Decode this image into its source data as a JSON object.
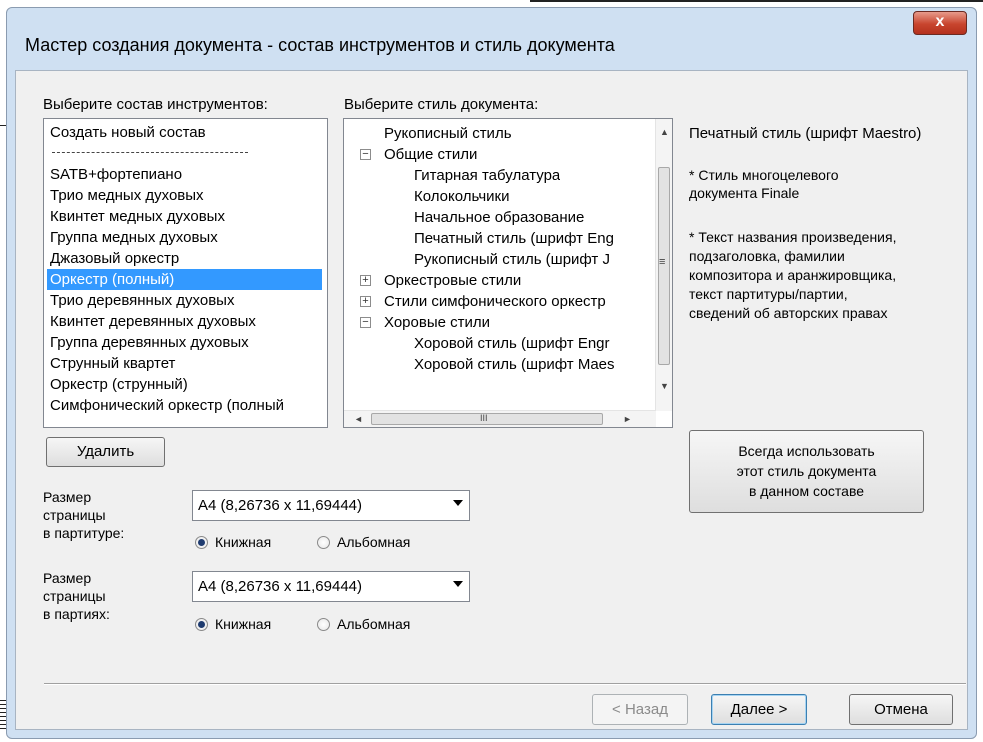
{
  "dialog": {
    "title": "Мастер создания документа - состав инструментов и стиль документа",
    "close_label": "x"
  },
  "ensemble": {
    "label": "Выберите состав инструментов:",
    "items": [
      {
        "label": "Создать новый состав",
        "selected": false
      },
      {
        "label": "SATB+фортепиано",
        "selected": false
      },
      {
        "label": "Трио медных духовых",
        "selected": false
      },
      {
        "label": "Квинтет медных духовых",
        "selected": false
      },
      {
        "label": "Группа медных духовых",
        "selected": false
      },
      {
        "label": "Джазовый оркестр",
        "selected": false
      },
      {
        "label": "Оркестр (полный)",
        "selected": true
      },
      {
        "label": "Трио деревянных духовых",
        "selected": false
      },
      {
        "label": "Квинтет деревянных духовых",
        "selected": false
      },
      {
        "label": "Группа деревянных духовых",
        "selected": false
      },
      {
        "label": "Струнный квартет",
        "selected": false
      },
      {
        "label": "Оркестр (струнный)",
        "selected": false
      },
      {
        "label": "Симфонический оркестр (полный",
        "selected": false
      }
    ],
    "delete_label": "Удалить"
  },
  "style": {
    "label": "Выберите стиль документа:",
    "tree": [
      {
        "label": "Рукописный стиль",
        "level": 0,
        "expander": ""
      },
      {
        "label": "Общие стили",
        "level": 0,
        "expander": "−"
      },
      {
        "label": "Гитарная табулатура",
        "level": 1,
        "expander": ""
      },
      {
        "label": "Колокольчики",
        "level": 1,
        "expander": ""
      },
      {
        "label": "Начальное образование",
        "level": 1,
        "expander": ""
      },
      {
        "label": "Печатный стиль (шрифт Eng",
        "level": 1,
        "expander": ""
      },
      {
        "label": "Рукописный стиль (шрифт J",
        "level": 1,
        "expander": ""
      },
      {
        "label": "Оркестровые стили",
        "level": 0,
        "expander": "+"
      },
      {
        "label": "Стили симфонического оркестр",
        "level": 0,
        "expander": "+"
      },
      {
        "label": "Хоровые стили",
        "level": 0,
        "expander": "−"
      },
      {
        "label": "Хоровой стиль (шрифт Engr",
        "level": 1,
        "expander": ""
      },
      {
        "label": "Хоровой стиль (шрифт Maes",
        "level": 1,
        "expander": ""
      }
    ],
    "scroll_up": "▲",
    "scroll_down": "▼",
    "scroll_left": "◄",
    "scroll_right": "►",
    "scroll_grip": "≡",
    "hscroll_grip": "III"
  },
  "description": {
    "title": "Печатный стиль (шрифт Maestro)",
    "bullet1_line1": "* Стиль многоцелевого",
    "bullet1_line2": "документа Finale",
    "bullet2_line1": "* Текст названия произведения,",
    "bullet2_line2": "подзаголовка, фамилии",
    "bullet2_line3": "композитора и аранжировщика,",
    "bullet2_line4": "текст партитуры/партии,",
    "bullet2_line5": "сведений об авторских правах"
  },
  "always_use": {
    "line1": "Всегда использовать",
    "line2": "этот стиль документа",
    "line3": "в данном составе"
  },
  "score_page": {
    "label_line1": "Размер",
    "label_line2": "страницы",
    "label_line3": "в партитуре:",
    "size_value": "A4 (8,26736 x 11,69444)",
    "portrait": "Книжная",
    "landscape": "Альбомная",
    "orientation": "portrait"
  },
  "parts_page": {
    "label_line1": "Размер",
    "label_line2": "страницы",
    "label_line3": "в партиях:",
    "size_value": "A4 (8,26736 x 11,69444)",
    "portrait": "Книжная",
    "landscape": "Альбомная",
    "orientation": "portrait"
  },
  "footer": {
    "back_label": "< Назад",
    "next_label": "Далее >",
    "cancel_label": "Отмена"
  },
  "colors": {
    "selection": "#3399ff",
    "title_bar": "#cfe0f2",
    "close_button": "#c8452e"
  }
}
